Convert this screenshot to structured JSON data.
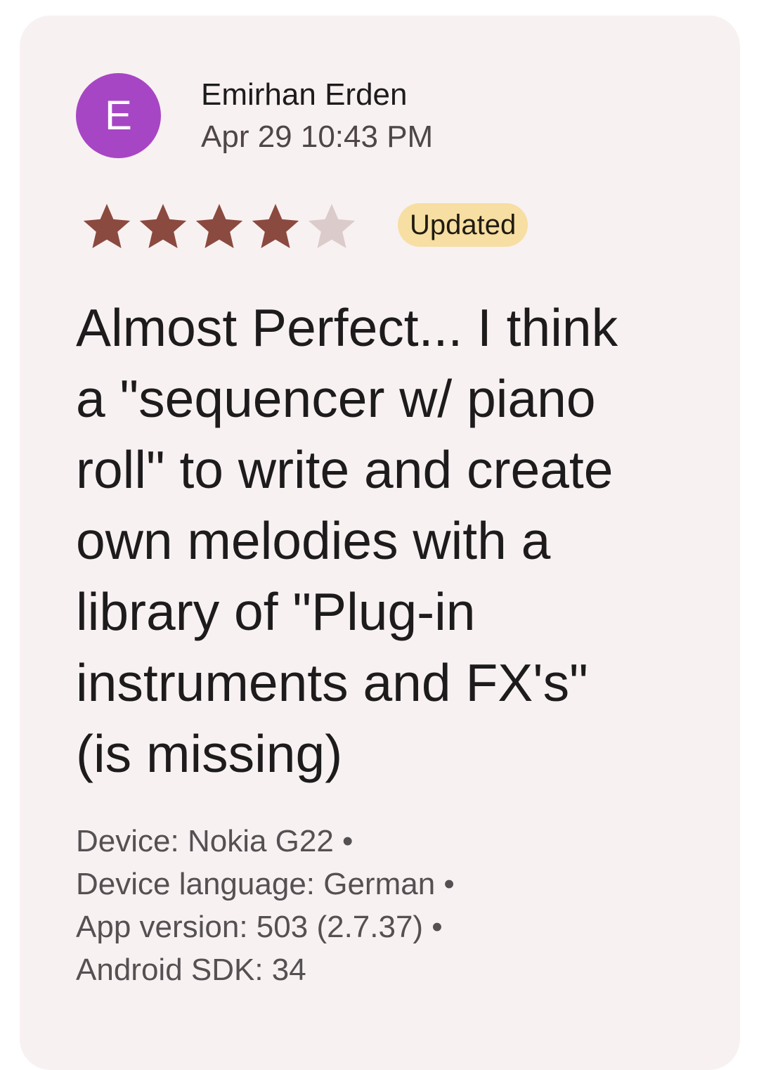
{
  "review": {
    "author_initial": "E",
    "author_name": "Emirhan Erden",
    "timestamp": "Apr 29 10:43 PM",
    "rating": 4,
    "rating_max": 5,
    "badge": "Updated",
    "text": "Almost Perfect... I think\na \"sequencer w/ piano\nroll\" to write and create\nown melodies with a\nlibrary of \"Plug-in\ninstruments and FX's\"\n(is missing)",
    "meta": [
      "Device: Nokia G22 •",
      "Device language: German •",
      "App version: 503 (2.7.37) •",
      "Android SDK: 34"
    ]
  },
  "colors": {
    "card_background": "#f8f1f2",
    "avatar": "#a746c4",
    "star_filled": "#8b4a3f",
    "star_empty": "#dccbcb",
    "badge_background": "#f7dea2"
  },
  "icons": {
    "star_filled": "star-filled-icon",
    "star_empty": "star-empty-icon"
  }
}
